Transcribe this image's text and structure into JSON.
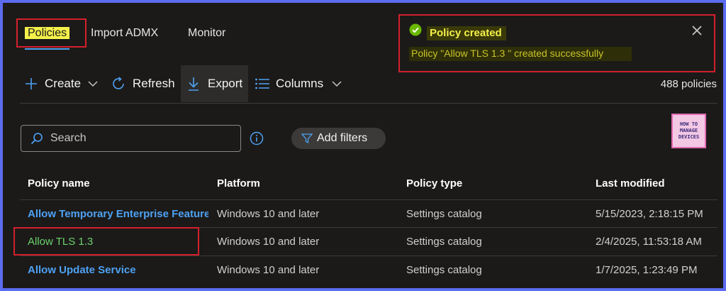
{
  "tabs": [
    {
      "label": "Policies"
    },
    {
      "label": "Import ADMX"
    },
    {
      "label": "Monitor"
    }
  ],
  "toast": {
    "title": "Policy created",
    "message": "Policy \"Allow TLS 1.3 \" created successfully",
    "close_icon": "close-icon",
    "status_icon": "check-circle-icon",
    "colors": {
      "highlight_text": "#f4f04a",
      "message_text": "#c9c42a",
      "border": "#d4202c"
    }
  },
  "toolbar": {
    "create_label": "Create",
    "refresh_label": "Refresh",
    "export_label": "Export",
    "columns_label": "Columns",
    "policy_count": "488 policies"
  },
  "search": {
    "placeholder": "Search"
  },
  "filters": {
    "add_label": "Add filters"
  },
  "logo": {
    "lines": [
      "HOW TO",
      "MANAGE",
      "DEVICES"
    ]
  },
  "table": {
    "headers": [
      "Policy name",
      "Platform",
      "Policy type",
      "Last modified"
    ],
    "rows": [
      {
        "name": "Allow Temporary Enterprise Feature",
        "platform": "Windows 10 and later",
        "type": "Settings catalog",
        "modified": "5/15/2023, 2:18:15 PM"
      },
      {
        "name": "Allow TLS 1.3",
        "platform": "Windows 10 and later",
        "type": "Settings catalog",
        "modified": "2/4/2025, 11:53:18 AM"
      },
      {
        "name": "Allow Update Service",
        "platform": "Windows 10 and later",
        "type": "Settings catalog",
        "modified": "1/7/2025, 1:23:49 PM"
      }
    ]
  },
  "colors": {
    "accent": "#4ea1f2",
    "background": "#1b1a19",
    "outline": "#5b6cf0"
  }
}
